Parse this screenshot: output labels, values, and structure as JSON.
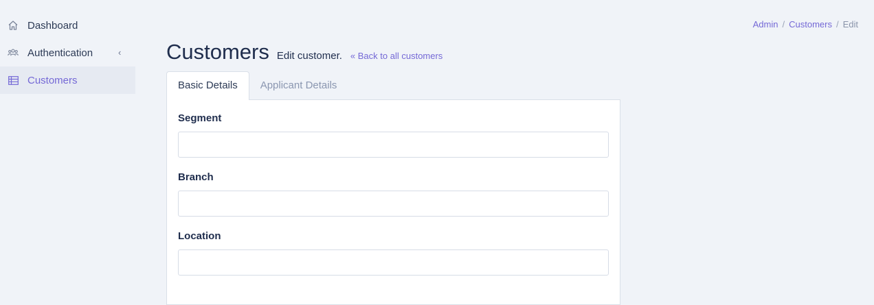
{
  "sidebar": {
    "items": [
      {
        "label": "Dashboard",
        "icon": "home-icon"
      },
      {
        "label": "Authentication",
        "icon": "users-icon",
        "expand": "‹"
      },
      {
        "label": "Customers",
        "icon": "table-icon"
      }
    ]
  },
  "breadcrumb": {
    "items": [
      "Admin",
      "Customers",
      "Edit"
    ],
    "separator": "/"
  },
  "header": {
    "title": "Customers",
    "subtitle": "Edit customer.",
    "back_link": "« Back to all customers"
  },
  "tabs": [
    "Basic Details",
    "Applicant Details"
  ],
  "form": {
    "fields": [
      {
        "label": "Segment",
        "value": "",
        "placeholder": ""
      },
      {
        "label": "Branch",
        "value": "",
        "placeholder": ""
      },
      {
        "label": "Location",
        "value": "",
        "placeholder": ""
      }
    ]
  },
  "colors": {
    "accent": "#7468d6",
    "background": "#f0f3f8",
    "text": "#1f2d4d"
  }
}
